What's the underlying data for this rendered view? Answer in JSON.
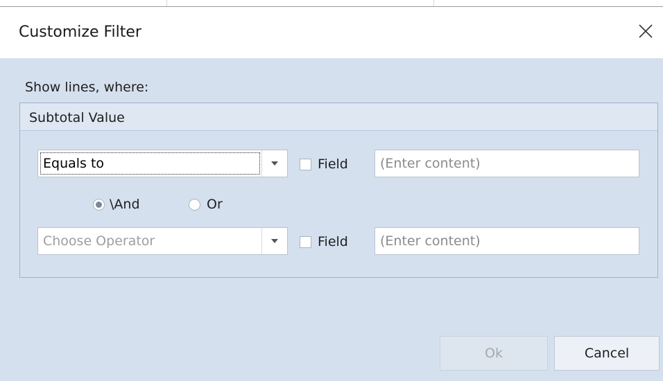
{
  "dialog": {
    "title": "Customize Filter",
    "close_icon": "close-icon",
    "prompt": "Show lines, where:"
  },
  "group": {
    "title": "Subtotal Value",
    "condition1": {
      "operator": "Equals to",
      "field_label": "Field",
      "field_checked": false,
      "value_placeholder": "(Enter content)"
    },
    "logic": {
      "and_label": "\\And",
      "or_label": "Or",
      "selected": "and"
    },
    "condition2": {
      "operator_placeholder": "Choose Operator",
      "field_label": "Field",
      "field_checked": false,
      "value_placeholder": "(Enter content)"
    }
  },
  "buttons": {
    "ok_label": "Ok",
    "cancel_label": "Cancel"
  },
  "colors": {
    "background": "#d5e0ee",
    "group_border": "#98b2d0",
    "header_background": "#dfe7f2"
  }
}
